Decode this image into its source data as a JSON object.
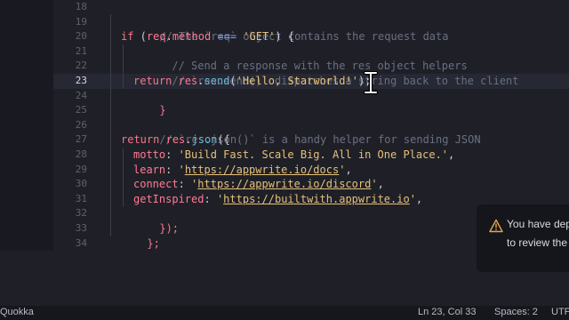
{
  "gutter": {
    "line_numbers": [
      "18",
      "19",
      "20",
      "21",
      "22",
      "23",
      "24",
      "25",
      "26",
      "27",
      "28",
      "29",
      "30",
      "31",
      "32",
      "33",
      "34"
    ],
    "active_line": "23"
  },
  "code": {
    "l19": {
      "comment": "// The `req` object contains the request data"
    },
    "l20": {
      "kw_if": "if",
      "open": " (",
      "obj": "req",
      "dot": ".",
      "prop": "method",
      "eq": " === ",
      "str": "'GET'",
      "close": ") {"
    },
    "l21": {
      "comment": "// Send a response with the res object helpers"
    },
    "l22": {
      "comment": "// `res.send()` dispatches a string back to the client"
    },
    "l23": {
      "kw": "return",
      "sp": " ",
      "obj": "res",
      "dot": ".",
      "fn": "send",
      "open": "(",
      "str": "'Hello, Starworld!'",
      "close": ");"
    },
    "l24": {
      "brace": "}"
    },
    "l26": {
      "comment": "// `res.json()` is a handy helper for sending JSON"
    },
    "l27": {
      "kw": "return",
      "sp": " ",
      "obj": "res",
      "dot": ".",
      "fn": "json",
      "open": "({"
    },
    "l28": {
      "key": "motto",
      "colon": ": ",
      "str": "'Build Fast. Scale Big. All in One Place.'",
      "comma": ","
    },
    "l29": {
      "key": "learn",
      "colon": ": ",
      "q1": "'",
      "url": "https://appwrite.io/docs",
      "q2": "'",
      "comma": ","
    },
    "l30": {
      "key": "connect",
      "colon": ": ",
      "q1": "'",
      "url": "https://appwrite.io/discord",
      "q2": "'",
      "comma": ","
    },
    "l31": {
      "key": "getInspired",
      "colon": ": ",
      "q1": "'",
      "url": "https://builtwith.appwrite.io",
      "q2": "'",
      "comma": ","
    },
    "l32": {
      "close": "});"
    },
    "l33": {
      "close": "};"
    }
  },
  "notification": {
    "line1": "You have dep",
    "line2": "to review the",
    "icon": "warning-icon"
  },
  "statusbar": {
    "left": "Quokka",
    "position": "Ln 23, Col 33",
    "spaces": "Spaces: 2",
    "encoding": "UTF"
  },
  "colors": {
    "background": "#1f2027",
    "keyword": "#f7768e",
    "string": "#e6c07b",
    "function": "#6cb7d6",
    "comment": "#6a6f82",
    "warning": "#e5a54b"
  }
}
